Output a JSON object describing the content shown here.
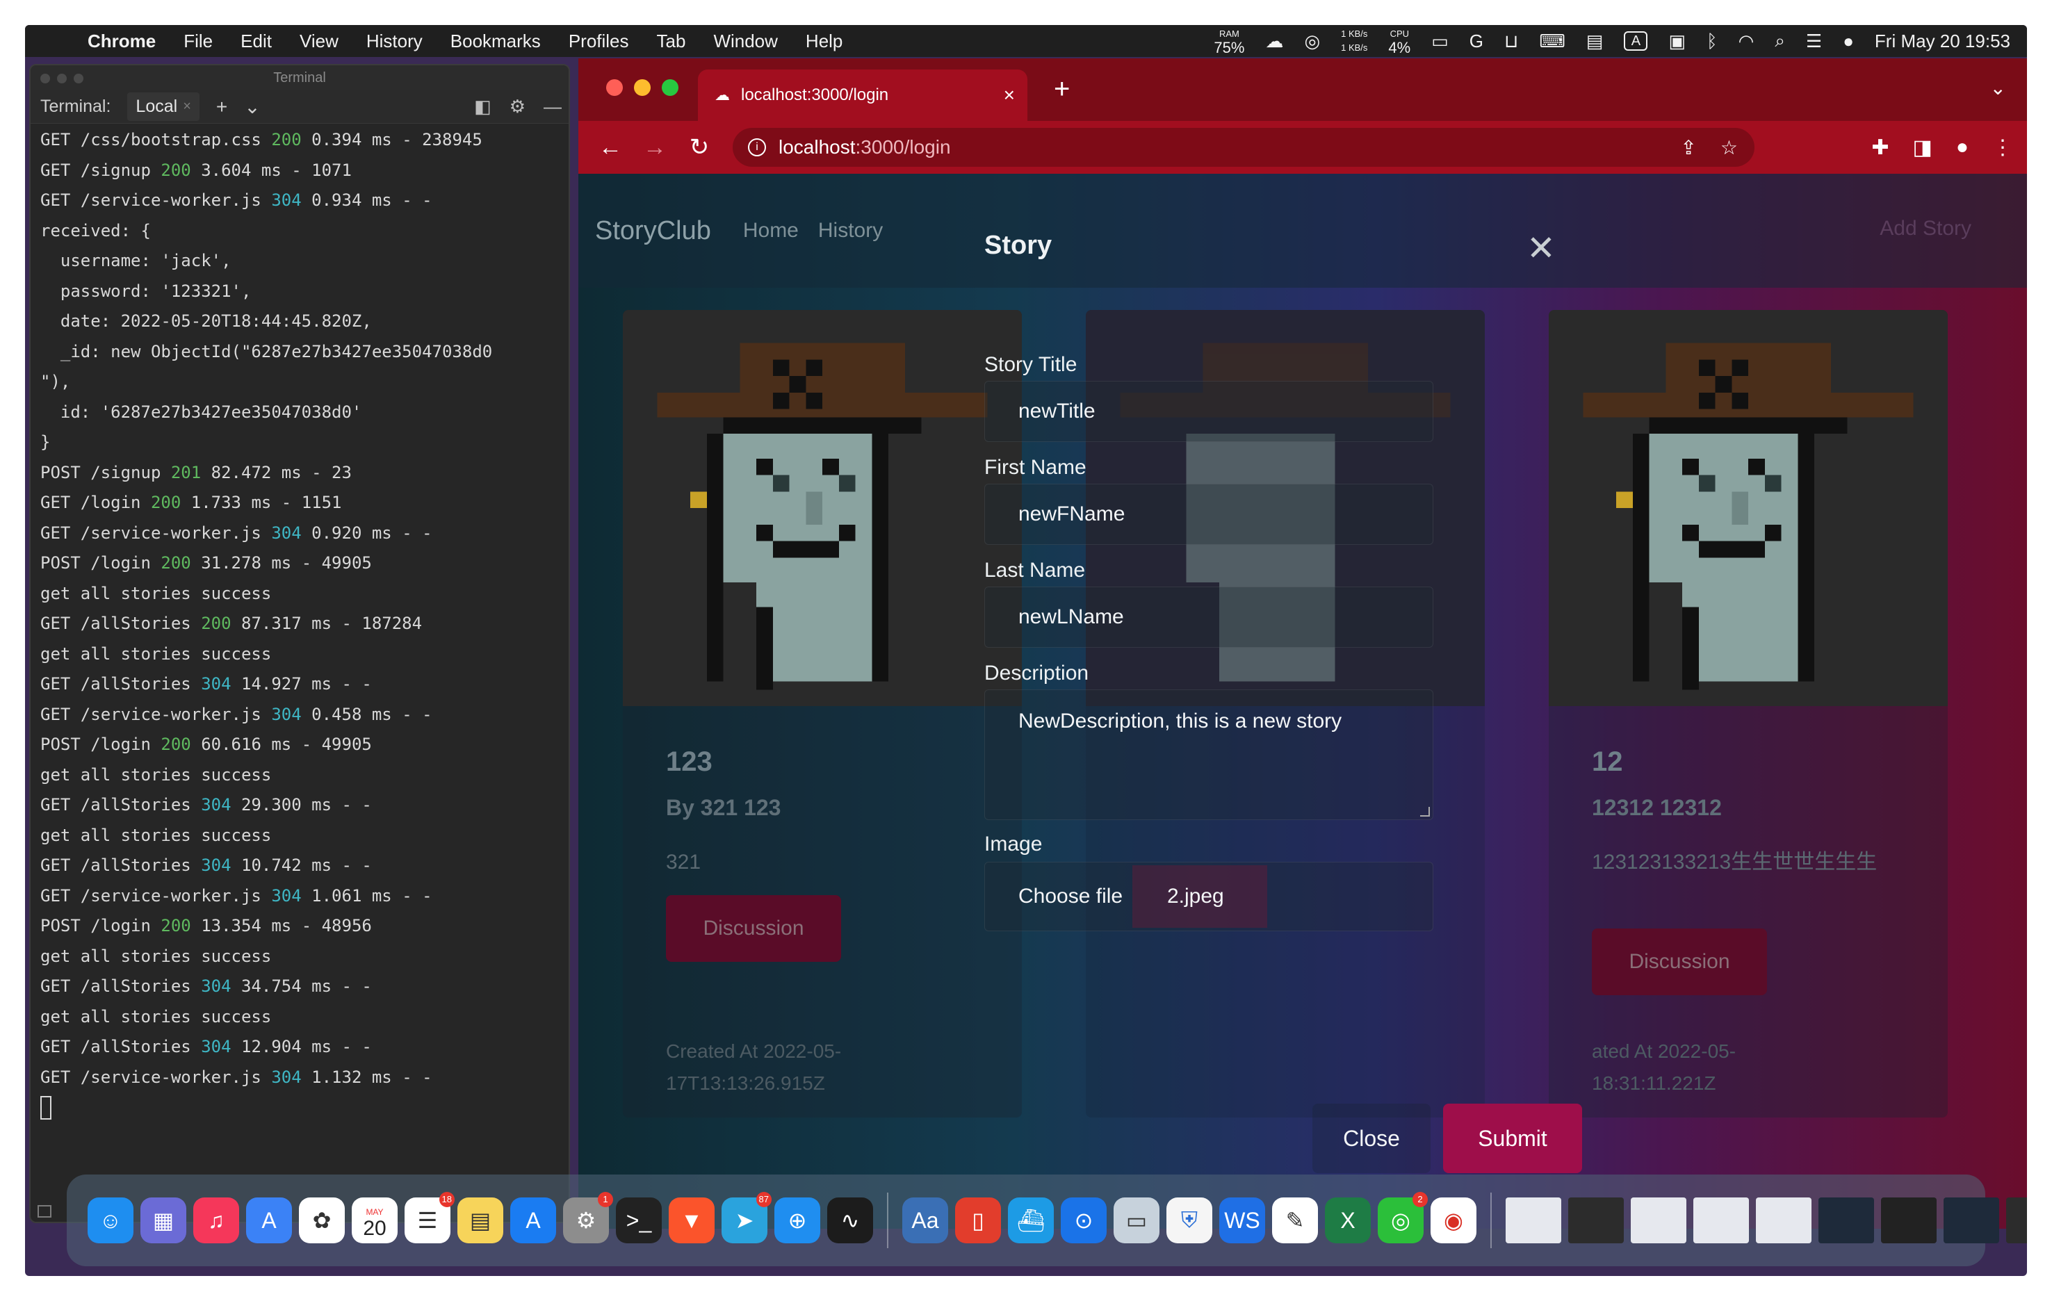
{
  "menubar": {
    "app": "Chrome",
    "items": [
      "File",
      "Edit",
      "View",
      "History",
      "Bookmarks",
      "Profiles",
      "Tab",
      "Window",
      "Help"
    ],
    "ram_label": "RAM",
    "ram_value": "75%",
    "net_up": "1 KB/s",
    "net_down": "1 KB/s",
    "cpu_label": "CPU",
    "cpu_value": "4%",
    "clock": "Fri May 20  19:53"
  },
  "terminal": {
    "window_title": "Terminal",
    "tab_label": "Terminal:",
    "tab_name": "Local",
    "lines": [
      {
        "pre": "GET /css/bootstrap.css ",
        "status": "200",
        "post": " 0.394 ms - 238945",
        "c": "green"
      },
      {
        "pre": "GET /signup ",
        "status": "200",
        "post": " 3.604 ms - 1071",
        "c": "green"
      },
      {
        "pre": "GET /service-worker.js ",
        "status": "304",
        "post": " 0.934 ms - -",
        "c": "cyan"
      },
      {
        "pre": "received: {",
        "status": "",
        "post": "",
        "c": ""
      },
      {
        "pre": "  username: 'jack',",
        "status": "",
        "post": "",
        "c": ""
      },
      {
        "pre": "  password: '123321',",
        "status": "",
        "post": "",
        "c": ""
      },
      {
        "pre": "  date: 2022-05-20T18:44:45.820Z,",
        "status": "",
        "post": "",
        "c": ""
      },
      {
        "pre": "  _id: new ObjectId(\"6287e27b3427ee35047038d0",
        "status": "",
        "post": "",
        "c": ""
      },
      {
        "pre": "\"),",
        "status": "",
        "post": "",
        "c": ""
      },
      {
        "pre": "  id: '6287e27b3427ee35047038d0'",
        "status": "",
        "post": "",
        "c": ""
      },
      {
        "pre": "}",
        "status": "",
        "post": "",
        "c": ""
      },
      {
        "pre": "POST /signup ",
        "status": "201",
        "post": " 82.472 ms - 23",
        "c": "green"
      },
      {
        "pre": "GET /login ",
        "status": "200",
        "post": " 1.733 ms - 1151",
        "c": "green"
      },
      {
        "pre": "GET /service-worker.js ",
        "status": "304",
        "post": " 0.920 ms - -",
        "c": "cyan"
      },
      {
        "pre": "POST /login ",
        "status": "200",
        "post": " 31.278 ms - 49905",
        "c": "green"
      },
      {
        "pre": "get all stories success",
        "status": "",
        "post": "",
        "c": ""
      },
      {
        "pre": "GET /allStories ",
        "status": "200",
        "post": " 87.317 ms - 187284",
        "c": "green"
      },
      {
        "pre": "get all stories success",
        "status": "",
        "post": "",
        "c": ""
      },
      {
        "pre": "GET /allStories ",
        "status": "304",
        "post": " 14.927 ms - -",
        "c": "cyan"
      },
      {
        "pre": "GET /service-worker.js ",
        "status": "304",
        "post": " 0.458 ms - -",
        "c": "cyan"
      },
      {
        "pre": "POST /login ",
        "status": "200",
        "post": " 60.616 ms - 49905",
        "c": "green"
      },
      {
        "pre": "get all stories success",
        "status": "",
        "post": "",
        "c": ""
      },
      {
        "pre": "GET /allStories ",
        "status": "304",
        "post": " 29.300 ms - -",
        "c": "cyan"
      },
      {
        "pre": "get all stories success",
        "status": "",
        "post": "",
        "c": ""
      },
      {
        "pre": "GET /allStories ",
        "status": "304",
        "post": " 10.742 ms - -",
        "c": "cyan"
      },
      {
        "pre": "GET /service-worker.js ",
        "status": "304",
        "post": " 1.061 ms - -",
        "c": "cyan"
      },
      {
        "pre": "POST /login ",
        "status": "200",
        "post": " 13.354 ms - 48956",
        "c": "green"
      },
      {
        "pre": "get all stories success",
        "status": "",
        "post": "",
        "c": ""
      },
      {
        "pre": "GET /allStories ",
        "status": "304",
        "post": " 34.754 ms - -",
        "c": "cyan"
      },
      {
        "pre": "get all stories success",
        "status": "",
        "post": "",
        "c": ""
      },
      {
        "pre": "GET /allStories ",
        "status": "304",
        "post": " 12.904 ms - -",
        "c": "cyan"
      },
      {
        "pre": "GET /service-worker.js ",
        "status": "304",
        "post": " 1.132 ms - -",
        "c": "cyan"
      }
    ]
  },
  "browser": {
    "tab_title": "localhost:3000/login",
    "url_host": "localhost",
    "url_path": ":3000/login"
  },
  "site": {
    "brand": "StoryClub",
    "nav_home": "Home",
    "nav_history": "History",
    "add_story": "Add Story",
    "cards": [
      {
        "title": "123",
        "by": "By 321 123",
        "desc": "321",
        "discussion": "Discussion",
        "created": "Created At 2022-05-17T13:13:26.915Z"
      },
      {
        "title": "12",
        "by": "12312 12312",
        "desc": "123123133213生生世世生生生",
        "discussion": "Discussion",
        "created": "ated At 2022-05-18:31:11.221Z"
      }
    ]
  },
  "modal": {
    "title": "Story",
    "story_title_label": "Story Title",
    "story_title_value": "newTitle",
    "first_name_label": "First Name",
    "first_name_value": "newFName",
    "last_name_label": "Last Name",
    "last_name_value": "newLName",
    "description_label": "Description",
    "description_value": "NewDescription, this is a new story",
    "image_label": "Image",
    "choose_file": "Choose file",
    "file_name": "2.jpeg",
    "close": "Close",
    "submit": "Submit"
  },
  "dock": {
    "calendar_month": "MAY",
    "calendar_day": "20",
    "badges": {
      "reminders": "18",
      "system_prefs": "1",
      "telegram": "87",
      "wechat": "2"
    }
  },
  "colors": {
    "chrome_tabbar": "#7a0c17",
    "chrome_toolbar": "#a20e1f",
    "submit": "#9e0e4a",
    "status_green": "#5fb95f",
    "status_cyan": "#3fb6c4"
  }
}
